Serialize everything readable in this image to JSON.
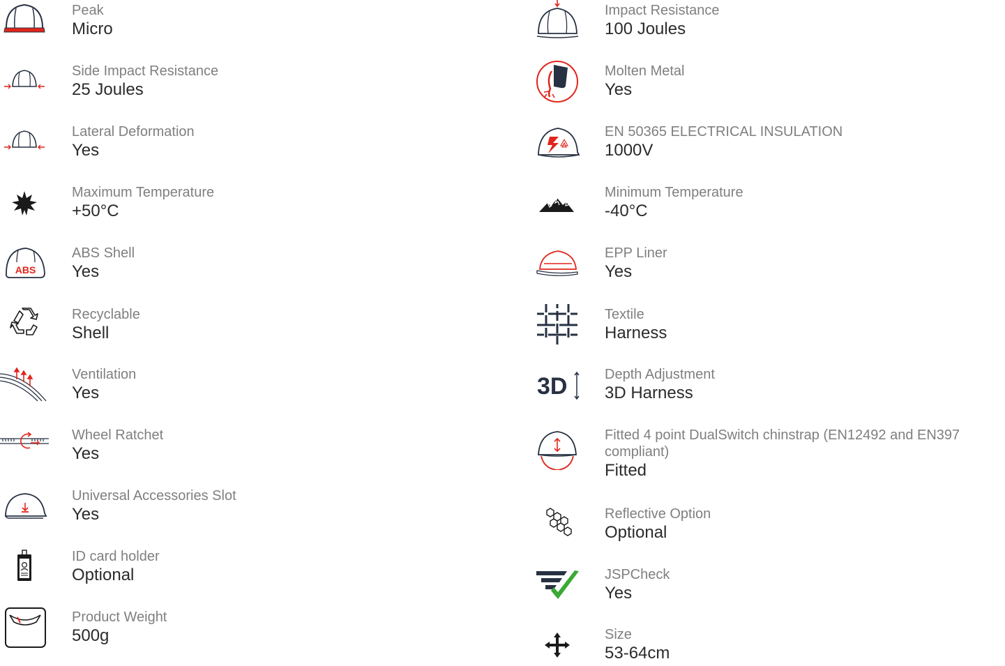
{
  "colors": {
    "accent": "#e1251b",
    "icon": "#273142",
    "check": "#3aa935",
    "label": "#7f7f7f",
    "value": "#2b2b2b"
  },
  "left": [
    {
      "icon": "peak-icon",
      "label": "Peak",
      "value": "Micro"
    },
    {
      "icon": "side-impact-icon",
      "label": "Side Impact Resistance",
      "value": "25 Joules"
    },
    {
      "icon": "lateral-deformation-icon",
      "label": "Lateral Deformation",
      "value": "Yes"
    },
    {
      "icon": "sun-icon",
      "label": "Maximum Temperature",
      "value": "+50°C"
    },
    {
      "icon": "abs-shell-icon",
      "label": "ABS Shell",
      "value": "Yes",
      "icon_text": "ABS"
    },
    {
      "icon": "recycle-icon",
      "label": "Recyclable",
      "value": "Shell"
    },
    {
      "icon": "ventilation-icon",
      "label": "Ventilation",
      "value": "Yes"
    },
    {
      "icon": "ratchet-icon",
      "label": "Wheel Ratchet",
      "value": "Yes"
    },
    {
      "icon": "accessory-slot-icon",
      "label": "Universal Accessories Slot",
      "value": "Yes"
    },
    {
      "icon": "id-card-icon",
      "label": "ID card holder",
      "value": "Optional"
    },
    {
      "icon": "weight-scale-icon",
      "label": "Product Weight",
      "value": "500g"
    }
  ],
  "right": [
    {
      "icon": "impact-resistance-icon",
      "label": "Impact Resistance",
      "value": "100 Joules"
    },
    {
      "icon": "molten-metal-icon",
      "label": "Molten Metal",
      "value": "Yes"
    },
    {
      "icon": "electrical-insulation-icon",
      "label": "EN 50365 ELECTRICAL INSULATION",
      "value": "1000V"
    },
    {
      "icon": "mountain-icon",
      "label": "Minimum Temperature",
      "value": "-40°C"
    },
    {
      "icon": "epp-liner-icon",
      "label": "EPP Liner",
      "value": "Yes"
    },
    {
      "icon": "textile-icon",
      "label": "Textile",
      "value": "Harness"
    },
    {
      "icon": "depth-adjustment-icon",
      "label": "Depth Adjustment",
      "value": "3D Harness",
      "icon_text": "3D"
    },
    {
      "icon": "chinstrap-icon",
      "label": "Fitted 4 point DualSwitch chinstrap (EN12492 and EN397 compliant)",
      "value": "Fitted"
    },
    {
      "icon": "reflective-icon",
      "label": "Reflective Option",
      "value": "Optional"
    },
    {
      "icon": "jspcheck-icon",
      "label": "JSPCheck",
      "value": "Yes"
    },
    {
      "icon": "move-arrows-icon",
      "label": "Size",
      "value": "53-64cm"
    }
  ]
}
